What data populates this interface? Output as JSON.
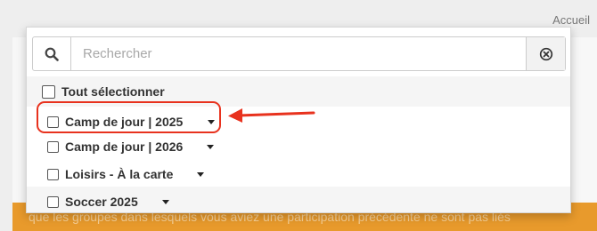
{
  "header": {
    "link_label": "Accueil"
  },
  "search": {
    "placeholder": "Rechercher",
    "search_icon": "search-icon",
    "clear_icon": "clear-circle-x-icon"
  },
  "select_all": {
    "label": "Tout sélectionner"
  },
  "options": [
    {
      "label": "Camp de jour | 2025",
      "highlighted": true
    },
    {
      "label": "Camp de jour | 2026"
    },
    {
      "label": "Loisirs - À la carte"
    },
    {
      "label": "Soccer 2025"
    }
  ],
  "background": {
    "banner_text": "que les groupes dans lesquels vous aviez une participation précédente ne sont pas liés"
  },
  "colors": {
    "accent_red": "#e8321e",
    "banner_orange": "#e89a2c"
  }
}
